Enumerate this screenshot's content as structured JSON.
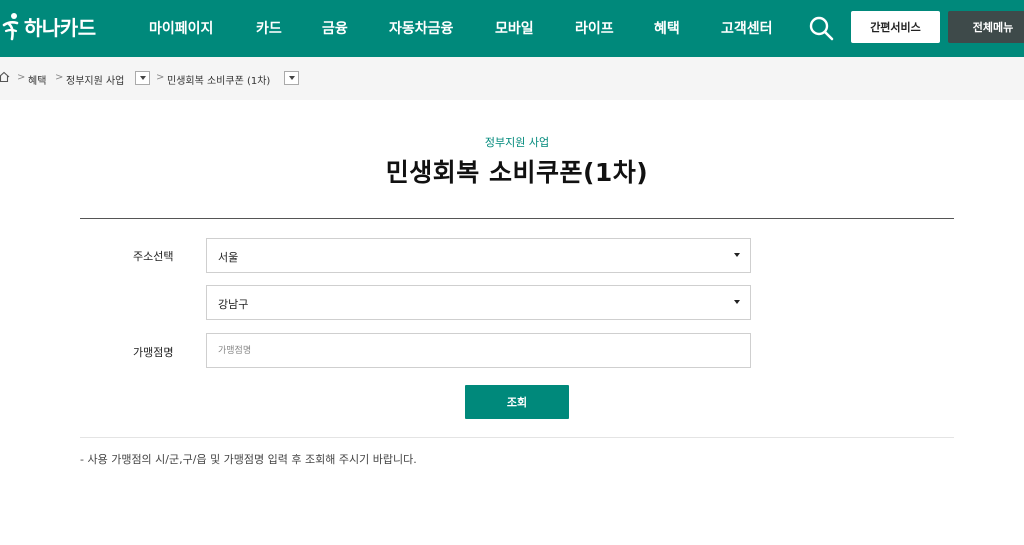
{
  "header": {
    "logo_text": "하나카드",
    "menu": [
      "마이페이지",
      "카드",
      "금융",
      "자동차금융",
      "모바일",
      "라이프",
      "혜택",
      "고객센터"
    ],
    "quick_service": "간편서비스",
    "all_menu": "전체메뉴"
  },
  "breadcrumb": {
    "items": [
      "혜택",
      "정부지원 사업",
      "민생회복 소비쿠폰 (1차)"
    ],
    "separator": ">"
  },
  "page": {
    "category": "정부지원 사업",
    "title": "민생회복 소비쿠폰(1차)"
  },
  "form": {
    "address_label": "주소선택",
    "city_value": "서울",
    "district_value": "강남구",
    "merchant_label": "가맹점명",
    "merchant_placeholder": "가맹점명",
    "merchant_value": "",
    "search_button": "조회"
  },
  "notice": "- 사용 가맹점의 시/군,구/읍 및 가맹점명 입력 후 조회해 주시기 바랍니다.",
  "colors": {
    "brand": "#00897b",
    "dark_button": "#3e4a4a",
    "breadcrumb_bg": "#f5f5f5"
  },
  "icons": [
    "hana-logo-icon",
    "search-icon",
    "home-icon",
    "chevron-down-icon"
  ]
}
